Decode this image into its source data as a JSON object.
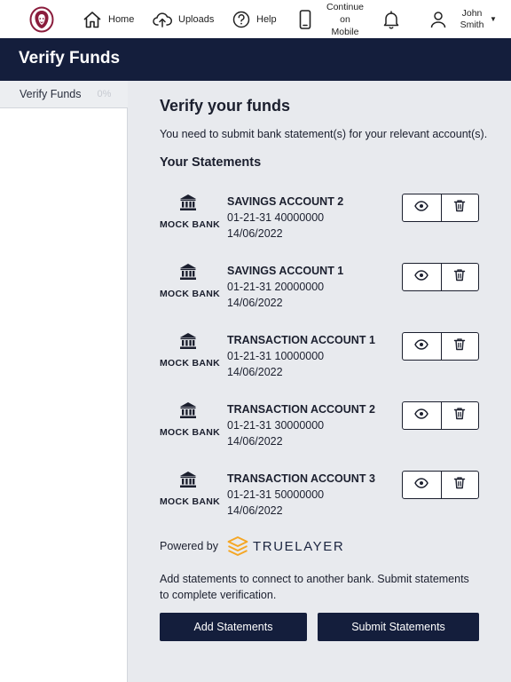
{
  "nav": {
    "home": "Home",
    "uploads": "Uploads",
    "help": "Help",
    "mobile_line1": "Continue",
    "mobile_line2": "on",
    "mobile_line3": "Mobile",
    "user_first": "John",
    "user_last": "Smith"
  },
  "page_title": "Verify Funds",
  "sidebar": {
    "items": [
      {
        "label": "Verify Funds",
        "progress": "0%"
      }
    ]
  },
  "main": {
    "heading": "Verify your funds",
    "intro": "You need to submit bank statement(s) for your relevant account(s).",
    "statements_heading": "Your Statements",
    "statements": [
      {
        "bank": "MOCK BANK",
        "account_name": "SAVINGS ACCOUNT 2",
        "account_number": "01-21-31 40000000",
        "date": "14/06/2022"
      },
      {
        "bank": "MOCK BANK",
        "account_name": "SAVINGS ACCOUNT 1",
        "account_number": "01-21-31 20000000",
        "date": "14/06/2022"
      },
      {
        "bank": "MOCK BANK",
        "account_name": "TRANSACTION ACCOUNT 1",
        "account_number": "01-21-31 10000000",
        "date": "14/06/2022"
      },
      {
        "bank": "MOCK BANK",
        "account_name": "TRANSACTION ACCOUNT 2",
        "account_number": "01-21-31 30000000",
        "date": "14/06/2022"
      },
      {
        "bank": "MOCK BANK",
        "account_name": "TRANSACTION ACCOUNT 3",
        "account_number": "01-21-31 50000000",
        "date": "14/06/2022"
      }
    ],
    "powered_by": "Powered by",
    "provider_name": "TRUELAYER",
    "note": "Add statements to connect to another bank. Submit statements to complete verification.",
    "add_button": "Add Statements",
    "submit_button": "Submit Statements"
  },
  "colors": {
    "navy": "#141e3c",
    "logo_maroon": "#8a1c3c",
    "truelayer_orange": "#f5a623"
  },
  "icons": [
    "lion-logo-icon",
    "home-icon",
    "upload-cloud-icon",
    "help-circle-icon",
    "mobile-phone-icon",
    "bell-icon",
    "user-icon",
    "bank-building-icon",
    "eye-icon",
    "trash-icon",
    "truelayer-logo-icon"
  ]
}
